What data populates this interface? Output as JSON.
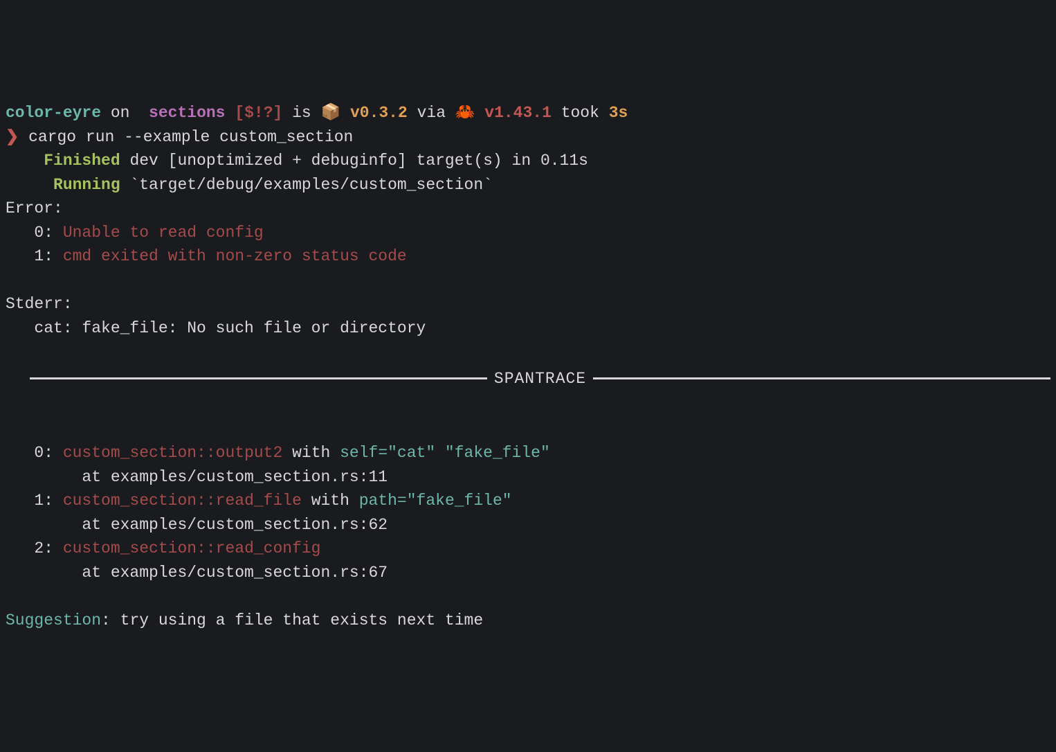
{
  "prompt": {
    "project": "color-eyre",
    "on": " on ",
    "branch_icon": "",
    "branch": " sections ",
    "git_status": "[$!?]",
    "is": " is ",
    "package_icon": "📦 ",
    "version": "v0.3.2",
    "via": " via ",
    "rust_icon": "🦀 ",
    "rust_version": "v1.43.1",
    "took": " took ",
    "duration": "3s",
    "arrow": "❯",
    "command": " cargo run --example custom_section"
  },
  "build": {
    "finished_label": "Finished",
    "finished_rest": " dev [unoptimized + debuginfo] target(s) in 0.11s",
    "running_label": "Running",
    "running_rest": " `target/debug/examples/custom_section`"
  },
  "error": {
    "label": "Error:",
    "lines": [
      {
        "idx": "   0: ",
        "msg": "Unable to read config"
      },
      {
        "idx": "   1: ",
        "msg": "cmd exited with non-zero status code"
      }
    ]
  },
  "stderr": {
    "label": "Stderr:",
    "line": "   cat: fake_file: No such file or directory"
  },
  "spantrace": {
    "label": "SPANTRACE",
    "frames": [
      {
        "idx": "   0: ",
        "func": "custom_section::output2",
        "with": " with ",
        "args": "self=\"cat\" \"fake_file\"",
        "at": "        at examples/custom_section.rs:11"
      },
      {
        "idx": "   1: ",
        "func": "custom_section::read_file",
        "with": " with ",
        "args": "path=\"fake_file\"",
        "at": "        at examples/custom_section.rs:62"
      },
      {
        "idx": "   2: ",
        "func": "custom_section::read_config",
        "with": "",
        "args": "",
        "at": "        at examples/custom_section.rs:67"
      }
    ]
  },
  "suggestion": {
    "label": "Suggestion",
    "colon": ": ",
    "text": "try using a file that exists next time"
  }
}
